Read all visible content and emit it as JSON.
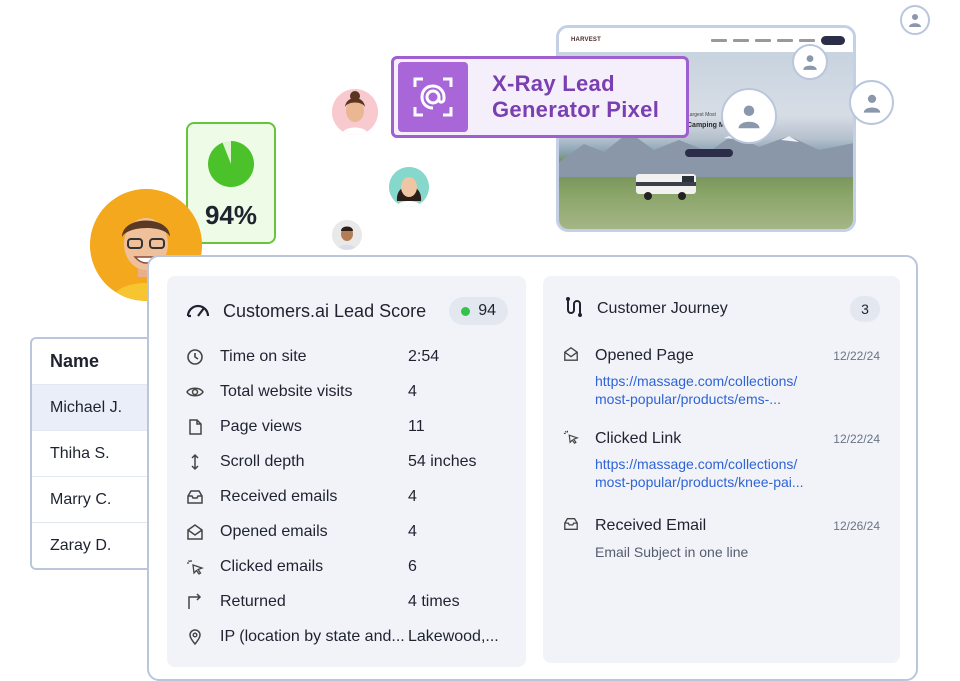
{
  "xray": {
    "label_line1": "X-Ray Lead",
    "label_line2": "Generator Pixel",
    "icon": "at-scan-icon"
  },
  "score_box": {
    "percent": "94%",
    "fill_fraction": 0.94
  },
  "website": {
    "logo_text": "HARVEST",
    "hero_title": "Camping Men",
    "hero_sub": "Largest Most"
  },
  "names": {
    "header": "Name",
    "rows": [
      "Michael J.",
      "Thiha S.",
      "Marry C.",
      "Zaray D."
    ]
  },
  "lead": {
    "title": "Customers.ai Lead Score",
    "score": "94",
    "metrics": [
      {
        "icon": "clock-icon",
        "label": "Time on site",
        "value": "2:54"
      },
      {
        "icon": "eye-icon",
        "label": "Total website visits",
        "value": "4"
      },
      {
        "icon": "page-icon",
        "label": "Page views",
        "value": "11"
      },
      {
        "icon": "scroll-icon",
        "label": "Scroll depth",
        "value": "54 inches"
      },
      {
        "icon": "inbox-icon",
        "label": "Received emails",
        "value": "4"
      },
      {
        "icon": "open-mail-icon",
        "label": "Opened emails",
        "value": "4"
      },
      {
        "icon": "click-icon",
        "label": "Clicked emails",
        "value": "6"
      },
      {
        "icon": "return-icon",
        "label": "Returned",
        "value": "4 times"
      },
      {
        "icon": "location-icon",
        "label": "IP (location by state and...",
        "value": "Lakewood,..."
      }
    ]
  },
  "journey": {
    "title": "Customer Journey",
    "count": "3",
    "events": [
      {
        "icon": "open-mail-icon",
        "title": "Opened Page",
        "date": "12/22/24",
        "line1": "https://massage.com/collections/",
        "line2": "most-popular/products/ems-..."
      },
      {
        "icon": "click-icon",
        "title": "Clicked Link",
        "date": "12/22/24",
        "line1": "https://massage.com/collections/",
        "line2": "most-popular/products/knee-pai..."
      },
      {
        "icon": "inbox-icon",
        "title": "Received Email",
        "date": "12/26/24",
        "sub": "Email Subject in one line"
      }
    ]
  }
}
